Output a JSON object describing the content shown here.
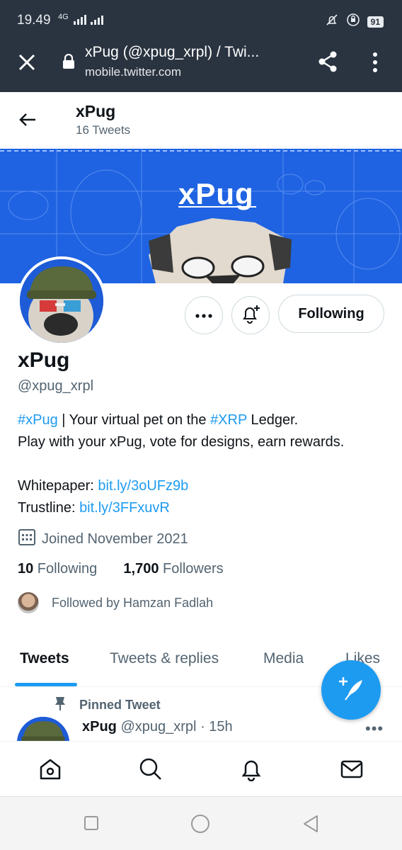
{
  "status_bar": {
    "time": "19.49",
    "network": "4G",
    "battery": "91"
  },
  "browser": {
    "page_title": "xPug (@xpug_xrpl) / Twi...",
    "url": "mobile.twitter.com"
  },
  "header": {
    "name": "xPug",
    "tweet_count": "16 Tweets"
  },
  "banner": {
    "title": "xPug"
  },
  "profile": {
    "display_name": "xPug",
    "handle": "@xpug_xrpl",
    "follow_button": "Following",
    "bio": {
      "hashtag1": "#xPug",
      "text1": " | Your virtual pet on the ",
      "hashtag2": "#XRP",
      "text2": " Ledger.",
      "line2": "Play with your xPug, vote for designs, earn rewards.",
      "whitepaper_label": "Whitepaper: ",
      "whitepaper_link": "bit.ly/3oUFz9b",
      "trustline_label": "Trustline: ",
      "trustline_link": "bit.ly/3FFxuvR"
    },
    "joined": "Joined November 2021",
    "following_count": "10",
    "following_label": " Following",
    "followers_count": "1,700",
    "followers_label": " Followers",
    "followed_by": "Followed by Hamzan Fadlah"
  },
  "tabs": [
    {
      "label": "Tweets",
      "active": true
    },
    {
      "label": "Tweets & replies",
      "active": false
    },
    {
      "label": "Media",
      "active": false
    },
    {
      "label": "Likes",
      "active": false
    }
  ],
  "pinned_tweet": {
    "pinned_label": "Pinned Tweet",
    "author": "xPug",
    "handle": "@xpug_xrpl",
    "time": "· 15h",
    "more": "•••"
  },
  "bottom_nav": [
    "home-icon",
    "search-icon",
    "notifications-icon",
    "messages-icon"
  ],
  "colors": {
    "accent": "#1d9bf0",
    "banner": "#1f63e2",
    "browser_bar": "#2a3340"
  }
}
